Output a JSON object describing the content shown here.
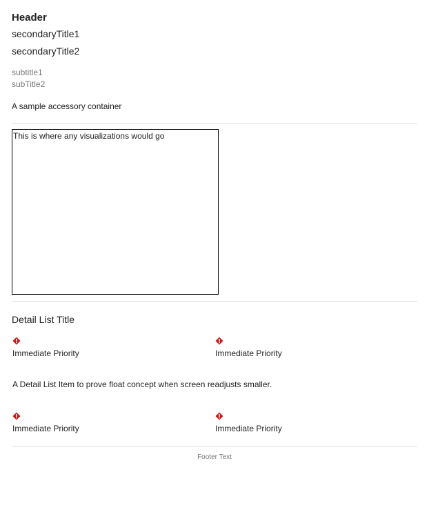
{
  "header": {
    "title": "Header",
    "secondary_title_1": "secondaryTitle1",
    "secondary_title_2": "secondaryTitle2",
    "subtitle_1": "subtitle1",
    "subtitle_2": "subTitle2",
    "accessory_text": "A sample accessory container"
  },
  "visualization": {
    "placeholder_text": "This is where any visualizations would go"
  },
  "detail_list": {
    "title": "Detail List Title",
    "items_row_1": [
      {
        "icon": "alert-diamond-icon",
        "label": "Immediate Priority"
      },
      {
        "icon": "alert-diamond-icon",
        "label": "Immediate Priority"
      }
    ],
    "float_item_text": "A Detail List Item to prove float concept when screen readjusts smaller.",
    "items_row_2": [
      {
        "icon": "alert-diamond-icon",
        "label": "Immediate Priority"
      },
      {
        "icon": "alert-diamond-icon",
        "label": "Immediate Priority"
      }
    ]
  },
  "footer": {
    "text": "Footer Text"
  },
  "colors": {
    "alert_red": "#cc1414",
    "text_primary": "#222222",
    "text_secondary": "#777777",
    "divider": "#dddddd"
  }
}
